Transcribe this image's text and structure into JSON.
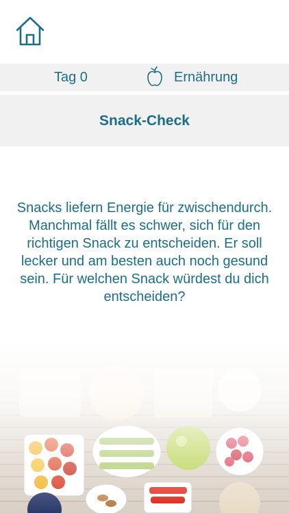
{
  "header": {
    "home_icon": "home-icon"
  },
  "info_bar": {
    "day_label": "Tag 0",
    "topic_icon": "apple-icon",
    "topic_label": "Ernährung"
  },
  "title": "Snack-Check",
  "body_text": "Snacks liefern Energie für zwischendurch. Manchmal fällt es schwer, sich für den richtigen Snack zu entscheiden. Er soll lecker und am besten auch noch gesund sein. Für welchen Snack würdest du dich entscheiden?",
  "colors": {
    "accent": "#1b6e86",
    "bar_background": "#f1f1f1"
  },
  "background_image": "healthy-snacks-on-wooden-table"
}
